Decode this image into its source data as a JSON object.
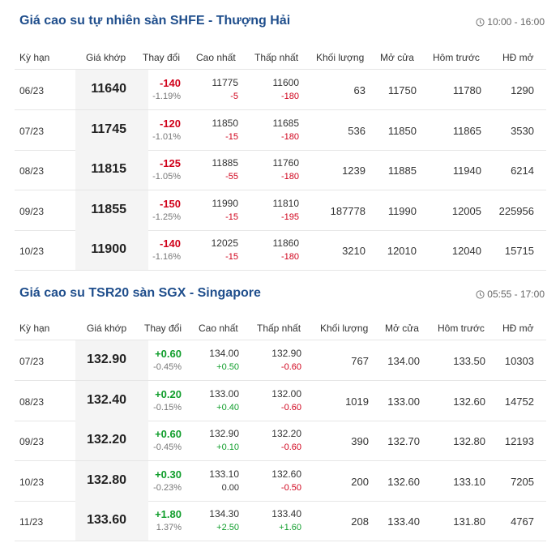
{
  "sections": [
    {
      "title": "Giá cao su tự nhiên sàn SHFE - Thượng Hải",
      "time": "10:00 - 16:00",
      "headers": [
        "Kỳ hạn",
        "Giá khớp",
        "Thay đổi",
        "Cao nhất",
        "Thấp nhất",
        "Khối lượng",
        "Mở cửa",
        "Hôm trước",
        "HĐ mở"
      ],
      "rows": [
        {
          "term": "06/23",
          "price": "11640",
          "change": "-140",
          "change_pct": "-1.19%",
          "high": "11775",
          "high_ch": "-5",
          "low": "11600",
          "low_ch": "-180",
          "volume": "63",
          "open": "11750",
          "prev": "11780",
          "oi": "1290"
        },
        {
          "term": "07/23",
          "price": "11745",
          "change": "-120",
          "change_pct": "-1.01%",
          "high": "11850",
          "high_ch": "-15",
          "low": "11685",
          "low_ch": "-180",
          "volume": "536",
          "open": "11850",
          "prev": "11865",
          "oi": "3530"
        },
        {
          "term": "08/23",
          "price": "11815",
          "change": "-125",
          "change_pct": "-1.05%",
          "high": "11885",
          "high_ch": "-55",
          "low": "11760",
          "low_ch": "-180",
          "volume": "1239",
          "open": "11885",
          "prev": "11940",
          "oi": "6214"
        },
        {
          "term": "09/23",
          "price": "11855",
          "change": "-150",
          "change_pct": "-1.25%",
          "high": "11990",
          "high_ch": "-15",
          "low": "11810",
          "low_ch": "-195",
          "volume": "187778",
          "open": "11990",
          "prev": "12005",
          "oi": "225956"
        },
        {
          "term": "10/23",
          "price": "11900",
          "change": "-140",
          "change_pct": "-1.16%",
          "high": "12025",
          "high_ch": "-15",
          "low": "11860",
          "low_ch": "-180",
          "volume": "3210",
          "open": "12010",
          "prev": "12040",
          "oi": "15715"
        }
      ]
    },
    {
      "title": "Giá cao su TSR20 sàn SGX - Singapore",
      "time": "05:55 - 17:00",
      "headers": [
        "Kỳ hạn",
        "Giá khớp",
        "Thay đổi",
        "Cao nhất",
        "Thấp nhất",
        "Khối lượng",
        "Mở cửa",
        "Hôm trước",
        "HĐ mở"
      ],
      "rows": [
        {
          "term": "07/23",
          "price": "132.90",
          "change": "+0.60",
          "change_pct": "-0.45%",
          "high": "134.00",
          "high_ch": "+0.50",
          "low": "132.90",
          "low_ch": "-0.60",
          "volume": "767",
          "open": "134.00",
          "prev": "133.50",
          "oi": "10303"
        },
        {
          "term": "08/23",
          "price": "132.40",
          "change": "+0.20",
          "change_pct": "-0.15%",
          "high": "133.00",
          "high_ch": "+0.40",
          "low": "132.00",
          "low_ch": "-0.60",
          "volume": "1019",
          "open": "133.00",
          "prev": "132.60",
          "oi": "14752"
        },
        {
          "term": "09/23",
          "price": "132.20",
          "change": "+0.60",
          "change_pct": "-0.45%",
          "high": "132.90",
          "high_ch": "+0.10",
          "low": "132.20",
          "low_ch": "-0.60",
          "volume": "390",
          "open": "132.70",
          "prev": "132.80",
          "oi": "12193"
        },
        {
          "term": "10/23",
          "price": "132.80",
          "change": "+0.30",
          "change_pct": "-0.23%",
          "high": "133.10",
          "high_ch": "0.00",
          "low": "132.60",
          "low_ch": "-0.50",
          "volume": "200",
          "open": "132.60",
          "prev": "133.10",
          "oi": "7205"
        },
        {
          "term": "11/23",
          "price": "133.60",
          "change": "+1.80",
          "change_pct": "1.37%",
          "high": "134.30",
          "high_ch": "+2.50",
          "low": "133.40",
          "low_ch": "+1.60",
          "volume": "208",
          "open": "133.40",
          "prev": "131.80",
          "oi": "4767"
        }
      ]
    }
  ],
  "colors": {
    "title": "#1f4e8c",
    "negative": "#d0021b",
    "positive": "#119e2c"
  },
  "icons": {
    "time": "clock-icon"
  }
}
